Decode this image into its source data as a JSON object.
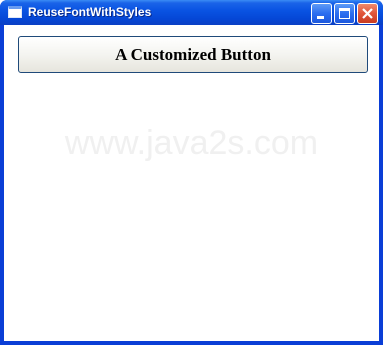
{
  "window": {
    "title": "ReuseFontWithStyles"
  },
  "titlebar": {
    "icons": [
      "app-window-icon",
      "minimize-icon",
      "maximize-icon",
      "close-icon"
    ],
    "close_glyph": "✕"
  },
  "content": {
    "button_label": "A Customized Button",
    "watermark": "www.java2s.com"
  },
  "colors": {
    "titlebar": "#0a54e3",
    "frame": "#0a3ed6",
    "close_button": "#e0553a",
    "button_border": "#1f4a7a"
  }
}
